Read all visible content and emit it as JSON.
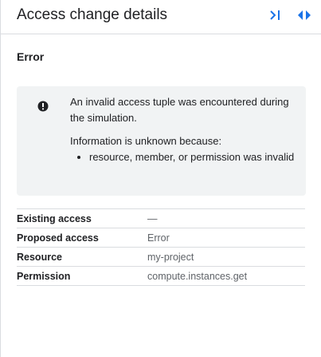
{
  "header": {
    "title": "Access change details",
    "collapse_icon": "collapse-panel-icon",
    "expand_icon": "expand-panel-icon",
    "accent_color": "#1a73e8"
  },
  "section": {
    "title": "Error"
  },
  "error_box": {
    "icon": "error-icon",
    "message": "An invalid access tuple was encountered during the simulation.",
    "reason_intro": "Information is unknown because:",
    "reasons": [
      "resource, member, or permission was invalid"
    ]
  },
  "details": {
    "rows": [
      {
        "key": "Existing access",
        "value": "—"
      },
      {
        "key": "Proposed access",
        "value": "Error"
      },
      {
        "key": "Resource",
        "value": "my-project"
      },
      {
        "key": "Permission",
        "value": "compute.instances.get"
      }
    ]
  }
}
